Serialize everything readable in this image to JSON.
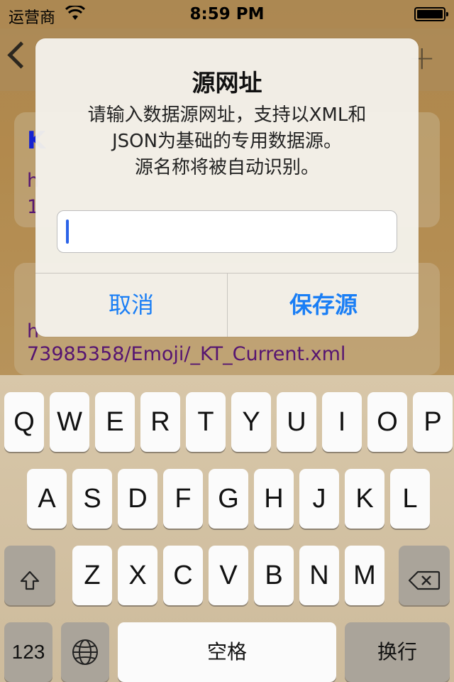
{
  "status": {
    "carrier": "运营商",
    "time": "8:59 PM"
  },
  "nav": {
    "title": ""
  },
  "cards": [
    {
      "title": "K",
      "url_lines": [
        "h",
        "1"
      ]
    },
    {
      "title": "",
      "url_lines": [
        "h",
        "73985358/Emoji/_KT_Current.xml"
      ]
    }
  ],
  "alert": {
    "title": "源网址",
    "message_lines": [
      "请输入数据源网址，支持以XML和",
      "JSON为基础的专用数据源。",
      "源名称将被自动识别。"
    ],
    "input_value": "",
    "cancel_label": "取消",
    "save_label": "保存源"
  },
  "keyboard": {
    "row1": [
      "Q",
      "W",
      "E",
      "R",
      "T",
      "Y",
      "U",
      "I",
      "O",
      "P"
    ],
    "row2": [
      "A",
      "S",
      "D",
      "F",
      "G",
      "H",
      "J",
      "K",
      "L"
    ],
    "row3": [
      "Z",
      "X",
      "C",
      "V",
      "B",
      "N",
      "M"
    ],
    "numbers_label": "123",
    "space_label": "空格",
    "return_label": "换行"
  },
  "colors": {
    "accent": "#1a7ef5",
    "caret": "#2b63e8"
  },
  "icons": [
    "wifi-icon",
    "battery-icon",
    "back-icon",
    "plus-icon",
    "shift-icon",
    "delete-icon",
    "globe-icon"
  ]
}
